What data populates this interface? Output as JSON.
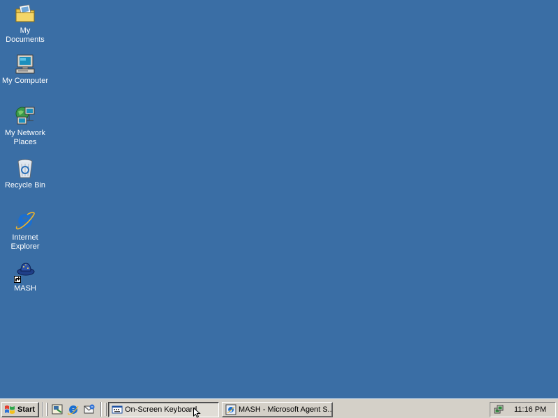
{
  "desktop": {
    "background_color": "#3a6ea5",
    "icons": [
      {
        "label": "My Documents",
        "icon": "my-documents-folder-icon"
      },
      {
        "label": "My Computer",
        "icon": "my-computer-icon"
      },
      {
        "label": "My Network Places",
        "icon": "network-places-icon"
      },
      {
        "label": "Recycle Bin",
        "icon": "recycle-bin-icon"
      },
      {
        "label": "Internet Explorer",
        "icon": "internet-explorer-icon"
      },
      {
        "label": "MASH",
        "icon": "mash-shortcut-icon"
      }
    ]
  },
  "taskbar": {
    "start_label": "Start",
    "quick_launch": [
      {
        "icon": "show-desktop-icon"
      },
      {
        "icon": "internet-explorer-icon"
      },
      {
        "icon": "outlook-express-icon"
      }
    ],
    "tasks": [
      {
        "label": "On-Screen Keyboard",
        "icon": "keyboard-window-icon",
        "active": true
      },
      {
        "label": "MASH - Microsoft Agent S...",
        "icon": "mash-window-icon",
        "active": false
      }
    ],
    "tray": {
      "clock": "11:16 PM",
      "icon": "network-tray-icon"
    }
  }
}
